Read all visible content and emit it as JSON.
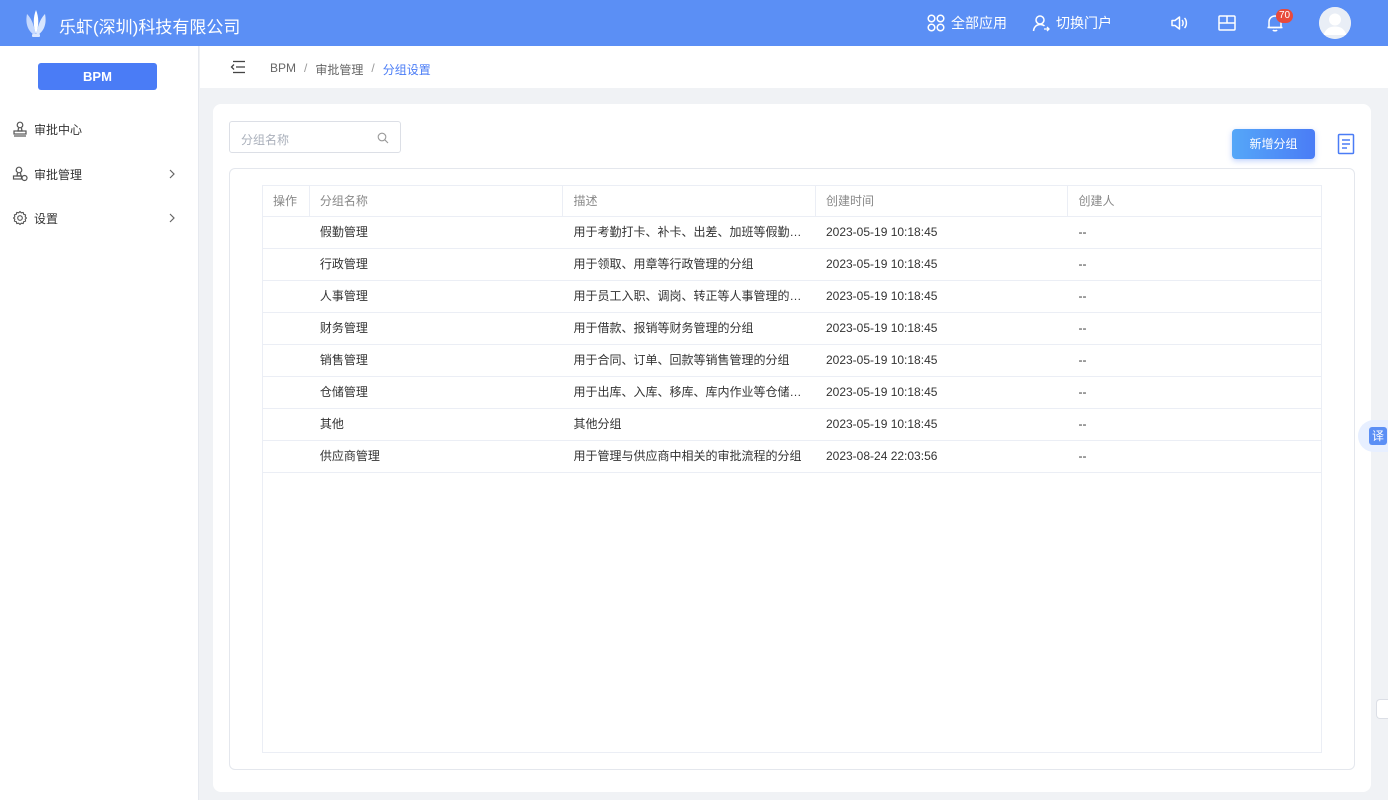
{
  "header": {
    "company": "乐虾(深圳)科技有限公司",
    "all_apps": "全部应用",
    "switch_portal": "切换门户",
    "notification_count": "70"
  },
  "sidebar": {
    "app_button": "BPM",
    "items": [
      {
        "label": "审批中心",
        "icon": "stamp-icon",
        "has_children": false
      },
      {
        "label": "审批管理",
        "icon": "approval-manage-icon",
        "has_children": true
      },
      {
        "label": "设置",
        "icon": "gear-icon",
        "has_children": true
      }
    ]
  },
  "breadcrumb": {
    "items": [
      "BPM",
      "审批管理",
      "分组设置"
    ]
  },
  "toolbar": {
    "search_placeholder": "分组名称",
    "new_button": "新增分组"
  },
  "table": {
    "columns": [
      "操作",
      "分组名称",
      "描述",
      "创建时间",
      "创建人"
    ],
    "rows": [
      {
        "name": "假勤管理",
        "desc": "用于考勤打卡、补卡、出差、加班等假勤管...",
        "created": "2023-05-19 10:18:45",
        "creator": "--"
      },
      {
        "name": "行政管理",
        "desc": "用于领取、用章等行政管理的分组",
        "created": "2023-05-19 10:18:45",
        "creator": "--"
      },
      {
        "name": "人事管理",
        "desc": "用于员工入职、调岗、转正等人事管理的分组",
        "created": "2023-05-19 10:18:45",
        "creator": "--"
      },
      {
        "name": "财务管理",
        "desc": "用于借款、报销等财务管理的分组",
        "created": "2023-05-19 10:18:45",
        "creator": "--"
      },
      {
        "name": "销售管理",
        "desc": "用于合同、订单、回款等销售管理的分组",
        "created": "2023-05-19 10:18:45",
        "creator": "--"
      },
      {
        "name": "仓储管理",
        "desc": "用于出库、入库、移库、库内作业等仓储管...",
        "created": "2023-05-19 10:18:45",
        "creator": "--"
      },
      {
        "name": "其他",
        "desc": "其他分组",
        "created": "2023-05-19 10:18:45",
        "creator": "--"
      },
      {
        "name": "供应商管理",
        "desc": "用于管理与供应商中相关的审批流程的分组",
        "created": "2023-08-24 22:03:56",
        "creator": "--"
      }
    ]
  },
  "translate_widget": {
    "label": "译"
  },
  "colors": {
    "header_bg": "#5b8ff5",
    "primary": "#4a7cf6",
    "badge": "#e84a3c"
  }
}
